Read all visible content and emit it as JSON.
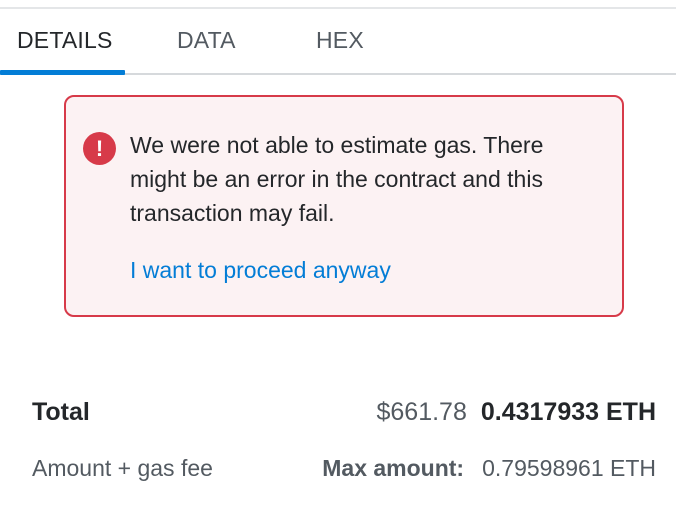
{
  "tabs": [
    {
      "label": "DETAILS",
      "active": true
    },
    {
      "label": "DATA",
      "active": false
    },
    {
      "label": "HEX",
      "active": false
    }
  ],
  "error": {
    "icon": "error-icon",
    "glyph": "!",
    "message": "We were not able to estimate gas. There might be an error in the contract and this transaction may fail.",
    "proceed_link": "I want to proceed anyway",
    "color": "#d73a49",
    "background": "#fcf2f3"
  },
  "summary": {
    "total_label": "Total",
    "total_fiat": "$661.78",
    "total_eth": "0.4317933 ETH",
    "amount_label": "Amount + gas fee",
    "max_label": "Max amount:",
    "max_value": "0.79598961 ETH"
  },
  "colors": {
    "accent": "#037dd6",
    "text": "#24272a",
    "muted": "#535a61"
  }
}
